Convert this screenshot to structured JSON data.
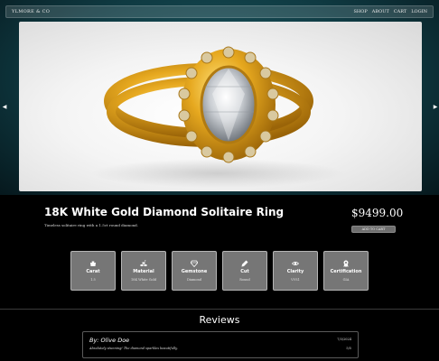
{
  "nav": {
    "brand": "YLMORE & CO",
    "links": [
      "SHOP",
      "ABOUT",
      "CART",
      "LOGIN"
    ]
  },
  "product": {
    "image_alt": "gold ring with oval diamond and halo",
    "title": "18K White Gold Diamond Solitaire Ring",
    "description": "Timeless solitaire ring with a 1.5ct round diamond.",
    "price": "$9499.00",
    "add_to_cart_label": "ADD TO CART"
  },
  "specs": [
    {
      "label": "Carat",
      "value": "1.5",
      "icon": "weight-icon"
    },
    {
      "label": "Material",
      "value": "18K White Gold",
      "icon": "material-icon"
    },
    {
      "label": "Gemstone",
      "value": "Diamond",
      "icon": "gem-icon"
    },
    {
      "label": "Cut",
      "value": "Round",
      "icon": "pencil-icon"
    },
    {
      "label": "Clarity",
      "value": "VVS1",
      "icon": "eye-icon"
    },
    {
      "label": "Certification",
      "value": "GIA",
      "icon": "award-icon"
    }
  ],
  "reviews": {
    "heading": "Reviews",
    "items": [
      {
        "author": "By: Olive Doe",
        "date": "7/3/2024",
        "text": "Absolutely stunning! The diamond sparkles beautifully.",
        "rating": "5/5"
      }
    ]
  },
  "colors": {
    "hero_background": "#0f3a42",
    "card_background": "#767676",
    "ring_gold": "#e6a81f"
  }
}
